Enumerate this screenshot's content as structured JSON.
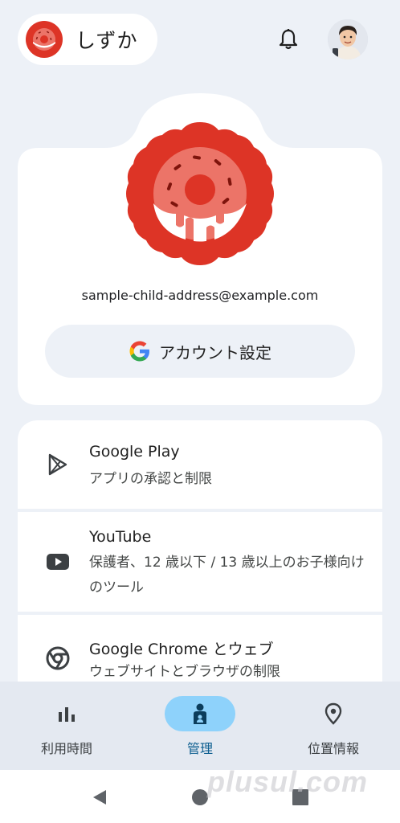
{
  "header": {
    "child_name": "しずか",
    "notification_icon": "bell-icon",
    "user_avatar_icon": "user-avatar"
  },
  "profile": {
    "email": "sample-child-address@example.com",
    "account_button_label": "アカウント設定",
    "badge_color": "#dd3426"
  },
  "settings": {
    "items": [
      {
        "icon": "google-play-icon",
        "title": "Google Play",
        "subtitle": "アプリの承認と制限"
      },
      {
        "icon": "youtube-icon",
        "title": "YouTube",
        "subtitle": "保護者、12 歳以下 / 13 歳以上のお子様向けのツール"
      },
      {
        "icon": "chrome-icon",
        "title": "Google Chrome とウェブ",
        "subtitle": "ウェブサイトとブラウザの制限"
      }
    ]
  },
  "nav": {
    "items": [
      {
        "icon": "bar-chart-icon",
        "label": "利用時間",
        "active": false
      },
      {
        "icon": "child-manage-icon",
        "label": "管理",
        "active": true
      },
      {
        "icon": "location-pin-icon",
        "label": "位置情報",
        "active": false
      }
    ]
  },
  "watermark": "plusul.com",
  "colors": {
    "background": "#edf1f7",
    "active_nav": "#8ed2fb",
    "accent_red": "#dd3426"
  }
}
